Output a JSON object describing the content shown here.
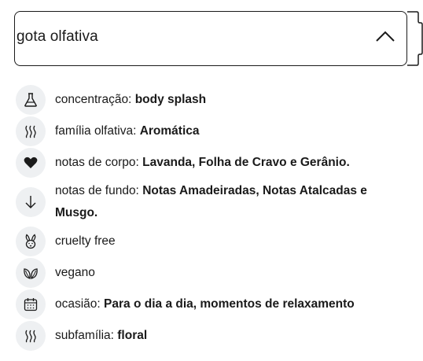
{
  "accordion": {
    "title": "gota olfativa",
    "state_icon": "chevron-up-icon"
  },
  "details": [
    {
      "icon": "flask-icon",
      "label": "concentração:",
      "value": "body splash"
    },
    {
      "icon": "scent-waves-icon",
      "label": "família olfativa:",
      "value": "Aromática"
    },
    {
      "icon": "heart-icon",
      "label": "notas de corpo:",
      "value": "Lavanda, Folha de Cravo e Gerânio."
    },
    {
      "icon": "arrow-down-icon",
      "label": "notas de fundo:",
      "value": "Notas Amadeiradas, Notas Atalcadas e Musgo."
    },
    {
      "icon": "rabbit-icon",
      "label": "cruelty free",
      "value": ""
    },
    {
      "icon": "leaves-icon",
      "label": "vegano",
      "value": ""
    },
    {
      "icon": "calendar-icon",
      "label": "ocasião:",
      "value": "Para o dia a dia, momentos de relaxamento"
    },
    {
      "icon": "scent-waves-icon",
      "label": "subfamília:",
      "value": "floral"
    }
  ]
}
